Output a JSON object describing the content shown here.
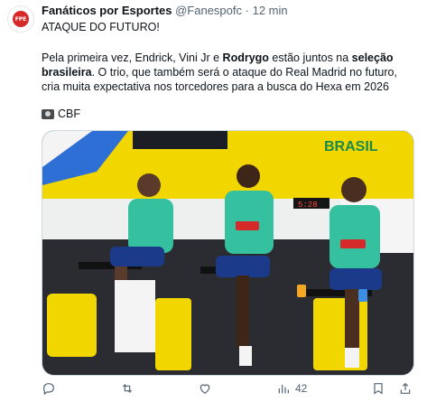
{
  "tweet": {
    "author_name": "Fanáticos por Esportes",
    "handle": "@Fanespofc",
    "separator": "·",
    "time": "12 min",
    "headline": "ATAQUE DO FUTURO!",
    "body_part1": "Pela primeira vez, Endrick, Vini Jr e ",
    "body_bold1": "Rodrygo",
    "body_part2": " estão juntos na ",
    "body_bold2": "seleção brasileira",
    "body_part3": ". O trio, que também será o ataque do Real Madrid no futuro, cria muita expectativa nos torcedores para a busca do Hexa em 2026",
    "credit": "CBF",
    "avatar_initials": "FPE"
  },
  "photo": {
    "wall_text": "BRASIL",
    "scoreboard": "5:28"
  },
  "actions": {
    "views_count": "42"
  },
  "icons": [
    "camera-icon",
    "reply-icon",
    "retweet-icon",
    "like-icon",
    "views-icon",
    "bookmark-icon",
    "share-icon"
  ],
  "colors": {
    "accent": "#1d9bf0",
    "muted": "#536471",
    "brand_yellow": "#f2d600",
    "kit_green": "#35c0a0"
  }
}
